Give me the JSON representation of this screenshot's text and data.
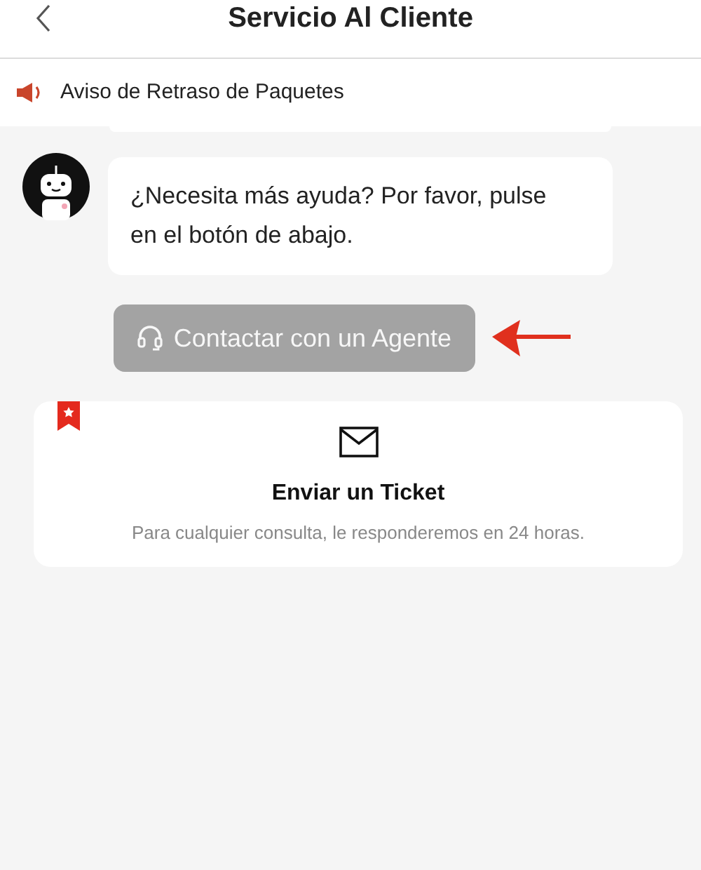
{
  "header": {
    "title": "Servicio Al Cliente"
  },
  "notice": {
    "text": "Aviso de Retraso de Paquetes"
  },
  "messages": [
    {
      "text": "¿Necesita más ayuda? Por favor, pulse en el botón de abajo."
    }
  ],
  "agent_button": {
    "label": "Contactar con un Agente",
    "disabled": true
  },
  "ticket_card": {
    "title": "Enviar un Ticket",
    "description": "Para cualquier consulta, le responderemos en 24 horas."
  }
}
